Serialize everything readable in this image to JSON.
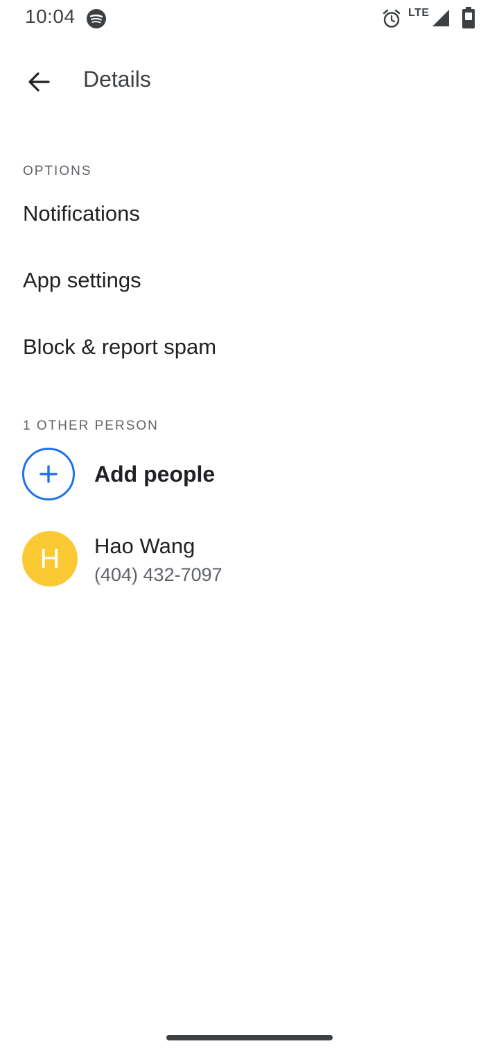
{
  "status_bar": {
    "time": "10:04",
    "network": "LTE",
    "icons": [
      "spotify-icon",
      "alarm-icon",
      "signal-icon",
      "battery-icon"
    ]
  },
  "app_bar": {
    "title": "Details",
    "back_icon": "arrow-back-icon"
  },
  "options_section": {
    "header": "OPTIONS",
    "items": [
      {
        "label": "Notifications"
      },
      {
        "label": "App settings"
      },
      {
        "label": "Block & report spam"
      }
    ]
  },
  "people_section": {
    "header": "1 OTHER PERSON",
    "add_people_label": "Add people",
    "contacts": [
      {
        "initial": "H",
        "name": "Hao Wang",
        "phone": "(404) 432-7097",
        "avatar_color": "#fbc934"
      }
    ]
  },
  "colors": {
    "accent": "#1a73e8",
    "avatar": "#fbc934"
  }
}
